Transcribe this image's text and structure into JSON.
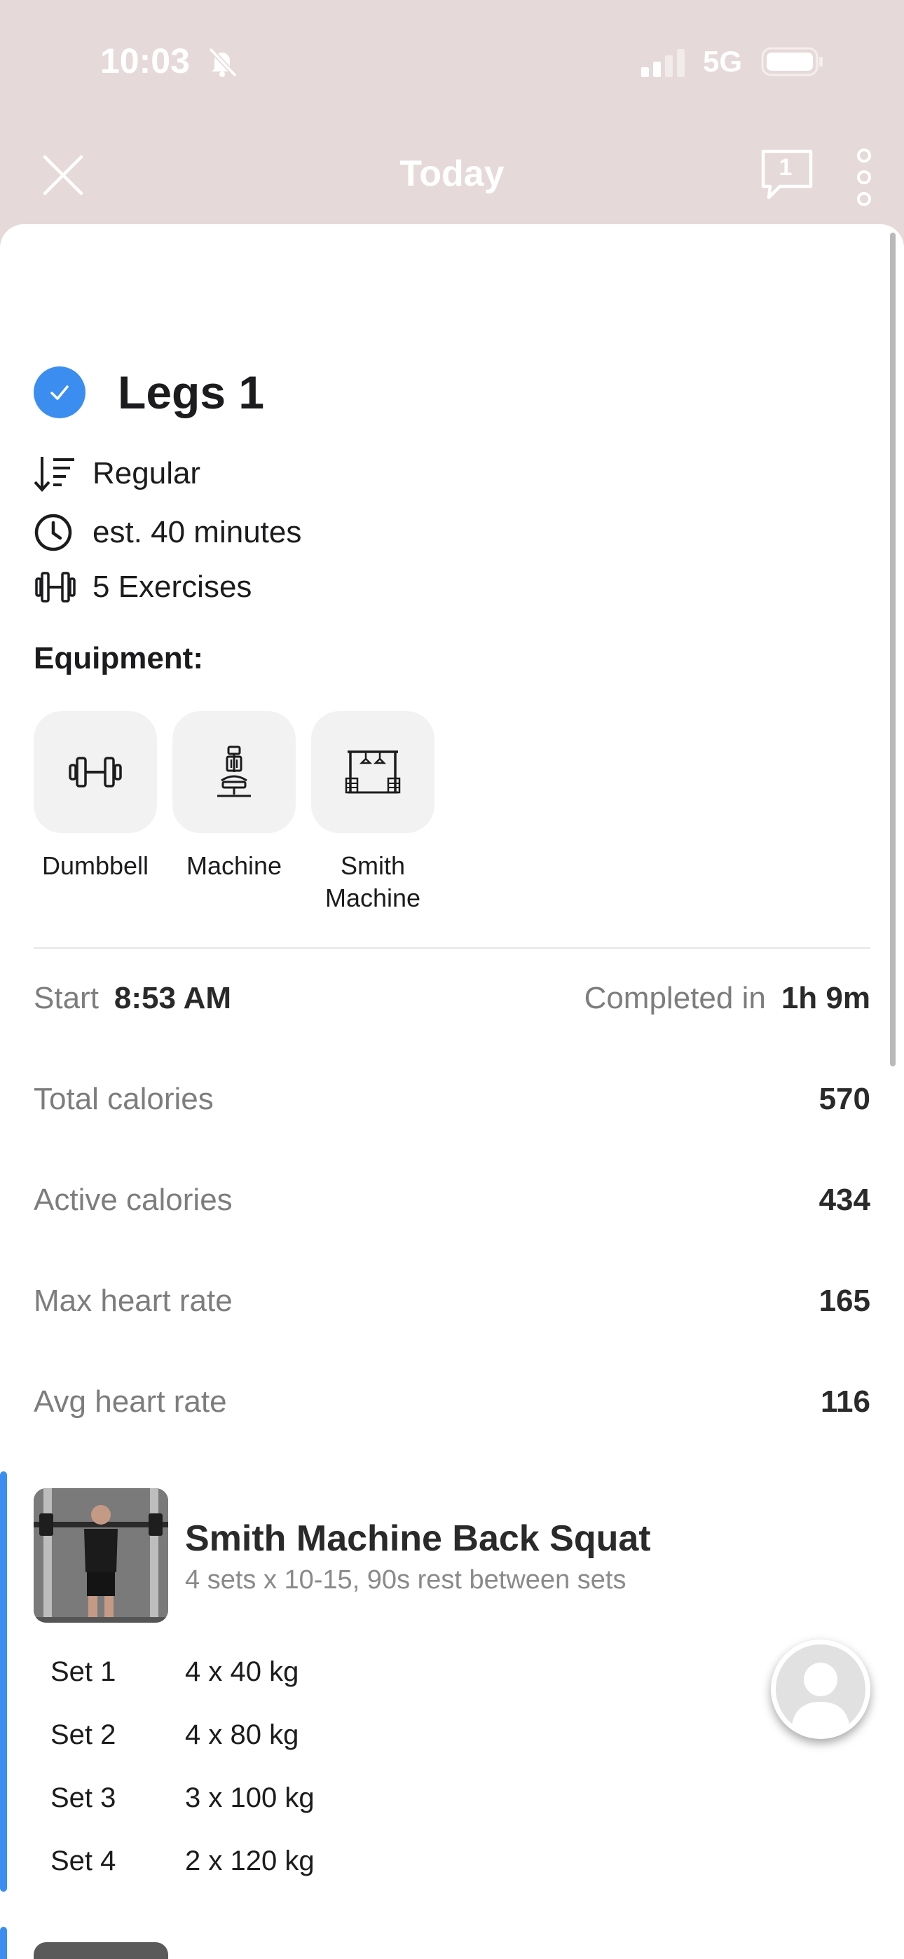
{
  "status_bar": {
    "time": "10:03",
    "network": "5G"
  },
  "nav": {
    "title": "Today",
    "comment_count": "1"
  },
  "workout": {
    "title": "Legs 1",
    "type": "Regular",
    "duration": "est. 40 minutes",
    "exercises_count": "5 Exercises",
    "equipment_label": "Equipment:",
    "equipment": [
      {
        "label": "Dumbbell",
        "icon": "dumbbell-icon"
      },
      {
        "label": "Machine",
        "icon": "machine-icon"
      },
      {
        "label": "Smith Machine",
        "icon": "smith-machine-icon"
      }
    ]
  },
  "stats": {
    "start_label": "Start",
    "start_value": "8:53 AM",
    "completed_label": "Completed in",
    "completed_value": "1h 9m",
    "rows": [
      {
        "label": "Total calories",
        "value": "570"
      },
      {
        "label": "Active calories",
        "value": "434"
      },
      {
        "label": "Max heart rate",
        "value": "165"
      },
      {
        "label": "Avg heart rate",
        "value": "116"
      }
    ]
  },
  "exercise": {
    "title": "Smith Machine Back Squat",
    "subtitle": "4 sets x 10-15, 90s rest between sets",
    "sets": [
      {
        "label": "Set 1",
        "value": "4 x 40 kg"
      },
      {
        "label": "Set 2",
        "value": "4 x 80 kg"
      },
      {
        "label": "Set 3",
        "value": "3 x 100 kg"
      },
      {
        "label": "Set 4",
        "value": "2 x 120 kg"
      }
    ]
  },
  "colors": {
    "accent": "#3b8ef0",
    "header_bg": "#e6d9d9"
  }
}
